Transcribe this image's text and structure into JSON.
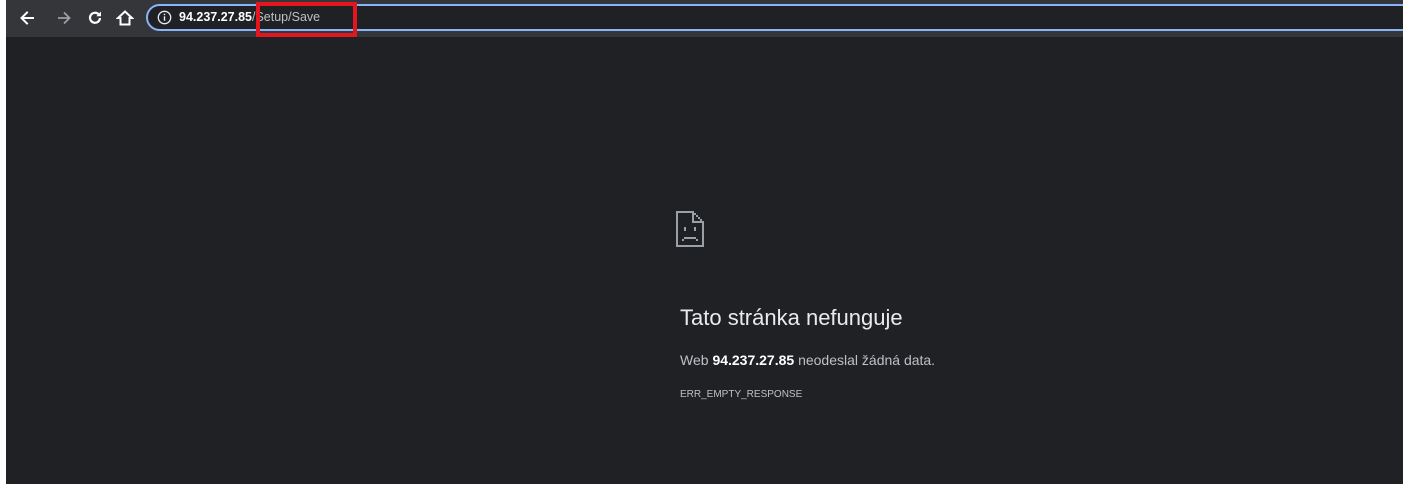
{
  "toolbar": {
    "back_icon": "arrow-left-icon",
    "forward_icon": "arrow-right-icon",
    "reload_icon": "reload-icon",
    "home_icon": "home-icon"
  },
  "omnibox": {
    "security_icon": "info-icon",
    "url_host": "94.237.27.85",
    "url_path": "/Setup/Save"
  },
  "error": {
    "icon": "sad-page-icon",
    "title": "Tato stránka nefunguje",
    "desc_prefix": "Web ",
    "desc_host": "94.237.27.85",
    "desc_suffix": " neodeslal žádná data.",
    "code": "ERR_EMPTY_RESPONSE"
  },
  "colors": {
    "page_background": "#202124",
    "toolbar_background": "#35363a",
    "omnibox_focus": "#8ab4f8",
    "highlight": "#e3161f",
    "title_text": "#e8eaed",
    "secondary_text": "#bdc1c6"
  }
}
